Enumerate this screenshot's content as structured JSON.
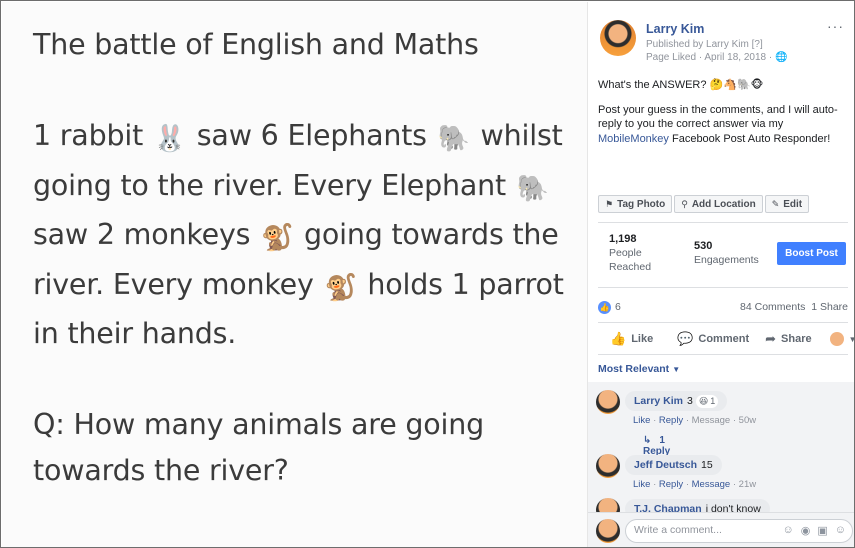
{
  "photo": {
    "title": "The battle of English and Maths",
    "lines": [
      "1 rabbit",
      "saw 6 Elephants",
      "whilst",
      "going to the river. Every Elephant",
      "saw 2 monkeys",
      "going towards the",
      "river. Every monkey",
      "holds 1 parrot",
      "in their hands.",
      "Q: How many animals are going",
      "towards the river?"
    ],
    "emoji": {
      "rabbit": "🐰",
      "elephant": "🐘",
      "monkey": "🐒"
    }
  },
  "post": {
    "author": "Larry Kim",
    "published_by": "Published by Larry Kim",
    "help_mark": "[?]",
    "meta": "Page Liked · April 18, 2018 ·",
    "more": "···",
    "caption_line1": "What's the ANSWER?",
    "caption_emoji": "🤔🐴🐘🐵",
    "caption_p2_before": "Post your guess in the comments, and I will auto-reply to you the correct answer via my",
    "caption_link": "MobileMonkey",
    "caption_p2_after": "Facebook Post Auto Responder!"
  },
  "chips": {
    "tag_photo": "Tag Photo",
    "add_location": "Add Location",
    "edit": "Edit"
  },
  "insights": {
    "reached_value": "1,198",
    "reached_label_1": "People",
    "reached_label_2": "Reached",
    "engagements_value": "530",
    "engagements_label": "Engagements",
    "boost_label": "Boost Post"
  },
  "reactions": {
    "count": "6",
    "comments": "84 Comments",
    "shares": "1 Share"
  },
  "actions": {
    "like": "Like",
    "comment": "Comment",
    "share": "Share"
  },
  "comments": {
    "sort_label": "Most Relevant",
    "items": [
      {
        "name": "Larry Kim",
        "text": "3",
        "react": "1",
        "meta_like": "Like",
        "meta_reply": "Reply",
        "meta_message": "Message",
        "time": "50w",
        "replies": "1 Reply"
      },
      {
        "name": "Jeff Deutsch",
        "text": "15",
        "meta_like": "Like",
        "meta_reply": "Reply",
        "meta_message": "Message",
        "time": "21w"
      },
      {
        "name": "T.J. Chapman",
        "text": "i don't know"
      }
    ],
    "write_placeholder": "Write a comment..."
  },
  "icons": {
    "more": "three-dots",
    "tag": "tag-icon",
    "location": "pin-icon",
    "edit": "pencil-icon"
  },
  "colors": {
    "link": "#385898",
    "boost": "#4080ff",
    "like_bubble": "#5890ff"
  }
}
